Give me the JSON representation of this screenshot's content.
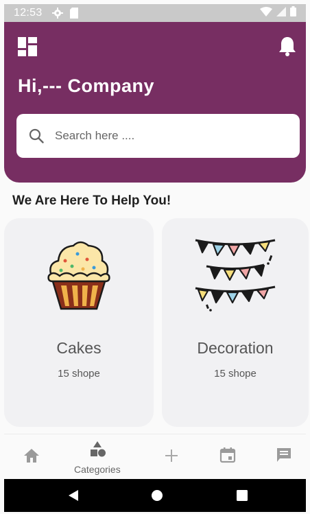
{
  "status_bar": {
    "time": "12:53"
  },
  "header": {
    "greeting": "Hi,--- Company"
  },
  "search": {
    "placeholder": "Search here ...."
  },
  "section": {
    "title": "We Are Here To Help You!"
  },
  "categories": [
    {
      "name": "Cakes",
      "count": "15 shope",
      "icon": "cupcake-icon"
    },
    {
      "name": "Decoration",
      "count": "15 shope",
      "icon": "bunting-flags-icon"
    }
  ],
  "bottom_nav": [
    {
      "icon": "home-icon",
      "label": ""
    },
    {
      "icon": "categories-icon",
      "label": "Categories",
      "active": true
    },
    {
      "icon": "add-icon",
      "label": ""
    },
    {
      "icon": "calendar-icon",
      "label": ""
    },
    {
      "icon": "message-icon",
      "label": ""
    }
  ],
  "colors": {
    "primary": "#772e62",
    "card": "#f1f1f3",
    "status_bar": "#c9c9c9"
  }
}
